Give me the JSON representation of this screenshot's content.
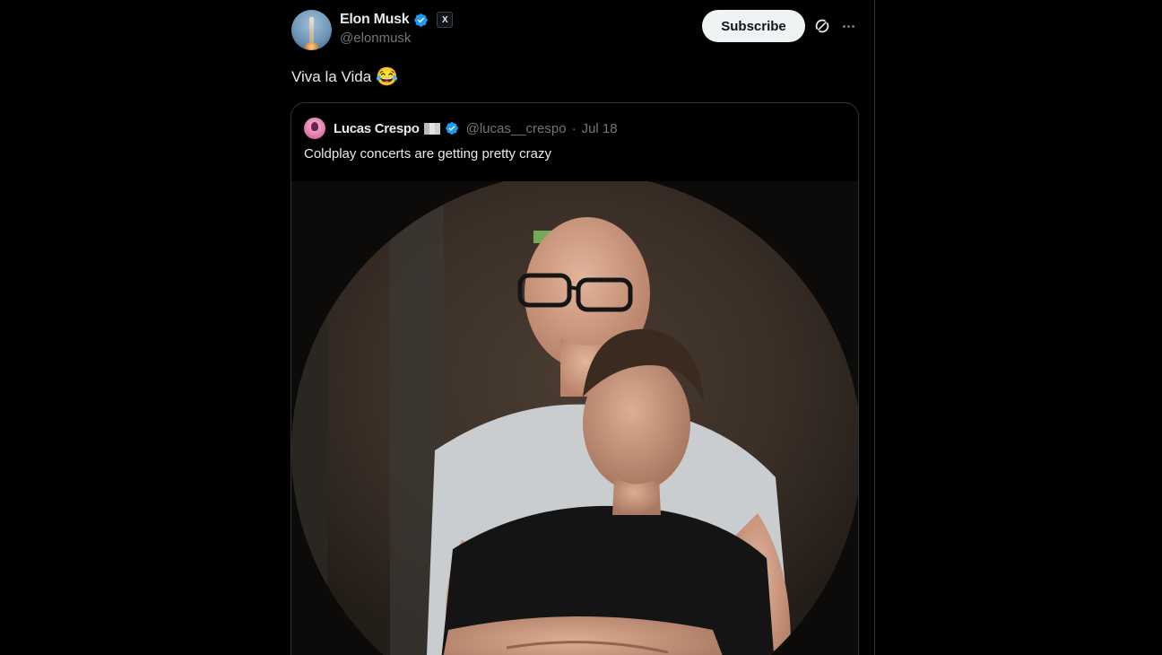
{
  "tweet": {
    "author": {
      "display_name": "Elon Musk",
      "handle": "@elonmusk",
      "verified": true,
      "affiliate_badge": "X"
    },
    "subscribe_label": "Subscribe",
    "text": "Viva la Vida",
    "emoji": "😂",
    "icons": [
      "verified-icon",
      "x-affiliate-icon",
      "grok-icon",
      "more-icon"
    ]
  },
  "quote": {
    "author": {
      "display_name": "Lucas Crespo",
      "handle": "@lucas__crespo",
      "separator": "·",
      "date": "Jul 18",
      "verified": true
    },
    "text": "Coldplay concerts are getting pretty crazy",
    "media": {
      "description_icon": "photo"
    }
  },
  "colors": {
    "background": "#000000",
    "primary_text": "#e7e9ea",
    "secondary_text": "#71767b",
    "verified_blue": "#1d9bf0",
    "subscribe_bg": "#eff3f4",
    "border": "#2f3336"
  }
}
